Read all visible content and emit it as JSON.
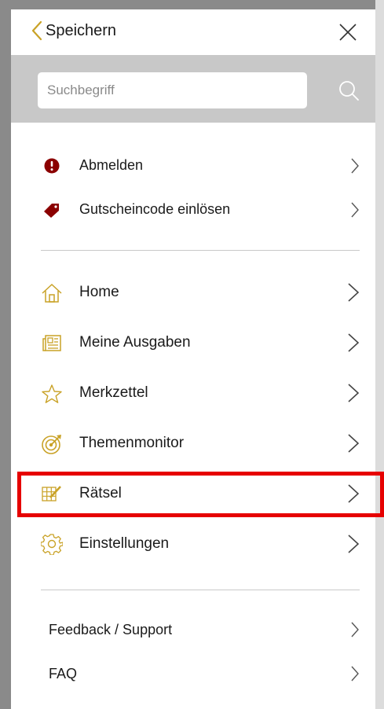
{
  "header": {
    "back_label": "Speichern"
  },
  "search": {
    "placeholder": "Suchbegriff"
  },
  "account_items": [
    {
      "label": "Abmelden",
      "icon": "alert-info-icon"
    },
    {
      "label": "Gutscheincode einlösen",
      "icon": "tag-icon"
    }
  ],
  "nav_items": [
    {
      "label": "Home",
      "icon": "home-icon"
    },
    {
      "label": "Meine Ausgaben",
      "icon": "newspaper-icon"
    },
    {
      "label": "Merkzettel",
      "icon": "star-icon"
    },
    {
      "label": "Themenmonitor",
      "icon": "target-icon"
    },
    {
      "label": "Rätsel",
      "icon": "crossword-pencil-icon"
    },
    {
      "label": "Einstellungen",
      "icon": "gear-icon"
    }
  ],
  "footer_items": [
    {
      "label": "Feedback / Support"
    },
    {
      "label": "FAQ"
    }
  ],
  "colors": {
    "accent_gold": "#c9a227",
    "alert_red": "#8b0000",
    "highlight_red": "#e60000",
    "search_bar_bg": "#c8c8c8"
  }
}
